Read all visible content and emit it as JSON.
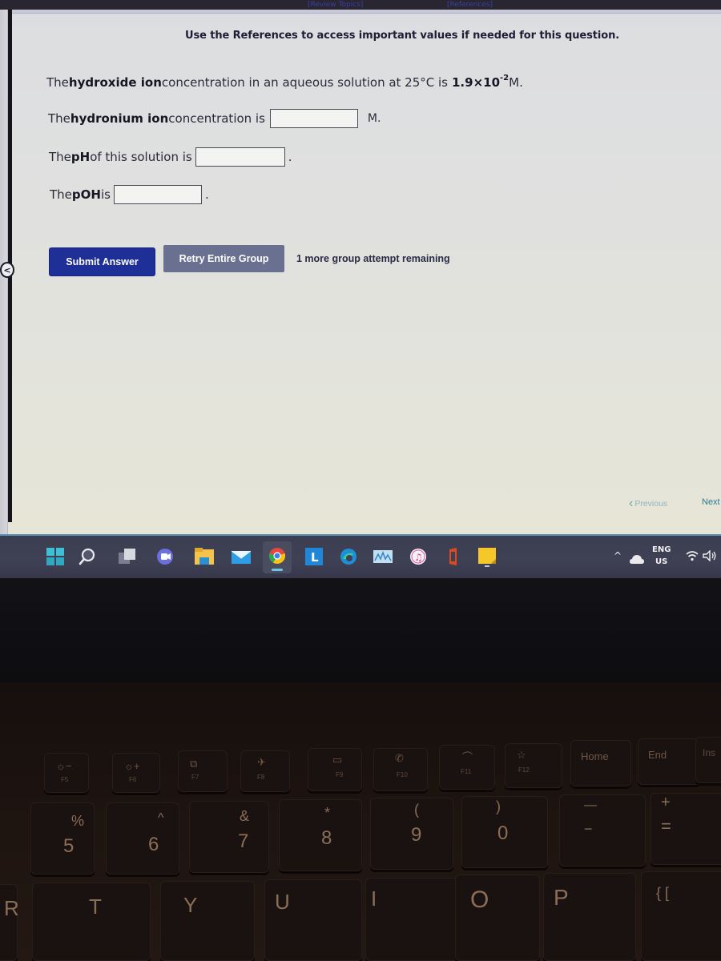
{
  "header": {
    "review_topics_link": "[Review Topics]",
    "references_link": "[References]",
    "references_note": "Use the References to access important values if needed for this question."
  },
  "question": {
    "line1": {
      "prefix": "The ",
      "bold": "hydroxide ion",
      "middle": " concentration in an aqueous solution at 25°C is ",
      "value_base": "1.9×10",
      "value_exp": "-2",
      "unit": " M."
    },
    "line2": {
      "prefix": "The ",
      "bold": "hydronium ion",
      "suffix": " concentration is",
      "unit": "M.",
      "value": ""
    },
    "line3": {
      "prefix": "The ",
      "bold": "pH",
      "suffix": " of this solution is",
      "unit": ".",
      "value": ""
    },
    "line4": {
      "prefix": "The ",
      "bold": "pOH",
      "suffix": " is",
      "unit": ".",
      "value": ""
    }
  },
  "actions": {
    "submit_label": "Submit Answer",
    "retry_label": "Retry Entire Group",
    "attempts_text": "1 more group attempt remaining",
    "back_glyph": "<"
  },
  "navigation": {
    "previous_label": "Previous",
    "next_label": "Next"
  },
  "taskbar": {
    "apps": [
      "start",
      "search",
      "task-view",
      "chat",
      "file-explorer",
      "mail",
      "chrome",
      "lexibook",
      "edge",
      "photos",
      "itunes",
      "office",
      "sticky-notes"
    ],
    "tray": {
      "language_line1": "ENG",
      "language_line2": "US"
    }
  },
  "keyboard": {
    "fkeys": [
      {
        "label": "F5",
        "glyph": "☼−"
      },
      {
        "label": "F6",
        "glyph": "☼+"
      },
      {
        "label": "F7",
        "glyph": "⧉"
      },
      {
        "label": "F8",
        "glyph": "✈"
      },
      {
        "label": "F9",
        "glyph": "▭"
      },
      {
        "label": "F10",
        "glyph": "✆"
      },
      {
        "label": "F11",
        "glyph": "⌒"
      },
      {
        "label": "F12",
        "glyph": "☆"
      }
    ],
    "nav_keys": [
      "Home",
      "End",
      "Ins"
    ],
    "number_row": [
      {
        "top": "%",
        "bottom": "5"
      },
      {
        "top": "^",
        "bottom": "6"
      },
      {
        "top": "&",
        "bottom": "7"
      },
      {
        "top": "*",
        "bottom": "8"
      },
      {
        "top": "(",
        "bottom": "9"
      },
      {
        "top": ")",
        "bottom": "0"
      },
      {
        "top": "—",
        "bottom": "−"
      },
      {
        "top": "+",
        "bottom": "="
      }
    ],
    "letter_row": [
      "R",
      "T",
      "Y",
      "U",
      "I",
      "O",
      "P",
      "{ ["
    ]
  }
}
